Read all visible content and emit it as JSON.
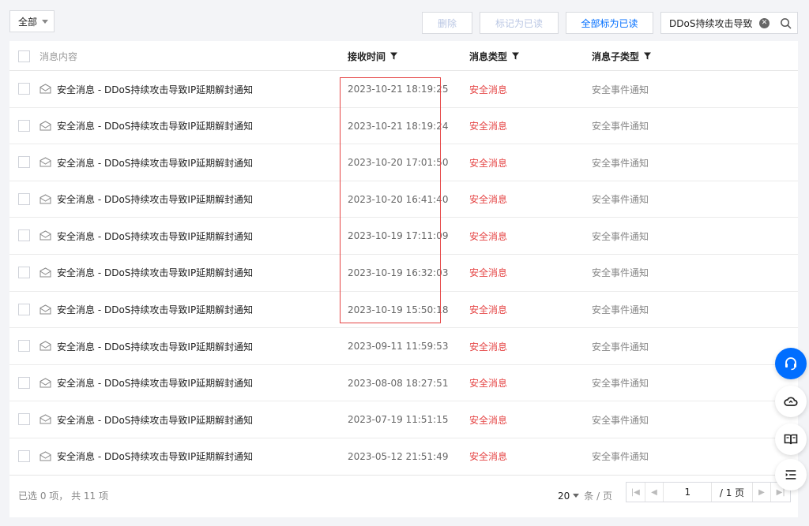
{
  "toolbar": {
    "filter_select": "全部",
    "delete_label": "删除",
    "mark_read_label": "标记为已读",
    "mark_all_read_label": "全部标为已读",
    "search_value": "DDoS持续攻击导致"
  },
  "table": {
    "columns": {
      "content": "消息内容",
      "time": "接收时间",
      "type": "消息类型",
      "subtype": "消息子类型"
    },
    "rows": [
      {
        "content": "安全消息 - DDoS持续攻击导致IP延期解封通知",
        "time": "2023-10-21 18:19:25",
        "type": "安全消息",
        "subtype": "安全事件通知"
      },
      {
        "content": "安全消息 - DDoS持续攻击导致IP延期解封通知",
        "time": "2023-10-21 18:19:24",
        "type": "安全消息",
        "subtype": "安全事件通知"
      },
      {
        "content": "安全消息 - DDoS持续攻击导致IP延期解封通知",
        "time": "2023-10-20 17:01:50",
        "type": "安全消息",
        "subtype": "安全事件通知"
      },
      {
        "content": "安全消息 - DDoS持续攻击导致IP延期解封通知",
        "time": "2023-10-20 16:41:40",
        "type": "安全消息",
        "subtype": "安全事件通知"
      },
      {
        "content": "安全消息 - DDoS持续攻击导致IP延期解封通知",
        "time": "2023-10-19 17:11:09",
        "type": "安全消息",
        "subtype": "安全事件通知"
      },
      {
        "content": "安全消息 - DDoS持续攻击导致IP延期解封通知",
        "time": "2023-10-19 16:32:03",
        "type": "安全消息",
        "subtype": "安全事件通知"
      },
      {
        "content": "安全消息 - DDoS持续攻击导致IP延期解封通知",
        "time": "2023-10-19 15:50:18",
        "type": "安全消息",
        "subtype": "安全事件通知"
      },
      {
        "content": "安全消息 - DDoS持续攻击导致IP延期解封通知",
        "time": "2023-09-11 11:59:53",
        "type": "安全消息",
        "subtype": "安全事件通知"
      },
      {
        "content": "安全消息 - DDoS持续攻击导致IP延期解封通知",
        "time": "2023-08-08 18:27:51",
        "type": "安全消息",
        "subtype": "安全事件通知"
      },
      {
        "content": "安全消息 - DDoS持续攻击导致IP延期解封通知",
        "time": "2023-07-19 11:51:15",
        "type": "安全消息",
        "subtype": "安全事件通知"
      },
      {
        "content": "安全消息 - DDoS持续攻击导致IP延期解封通知",
        "time": "2023-05-12 21:51:49",
        "type": "安全消息",
        "subtype": "安全事件通知"
      }
    ]
  },
  "footer": {
    "selected_info": "已选 0 项， 共 11 项",
    "page_size": "20",
    "page_size_unit": "条 / 页",
    "current_page": "1",
    "total_pages": "/ 1 页"
  },
  "icons": {
    "float_buttons": [
      "headset-icon",
      "cloud-icon",
      "book-icon",
      "list-icon"
    ]
  },
  "colors": {
    "accent": "#006eff",
    "danger": "#e54545"
  }
}
